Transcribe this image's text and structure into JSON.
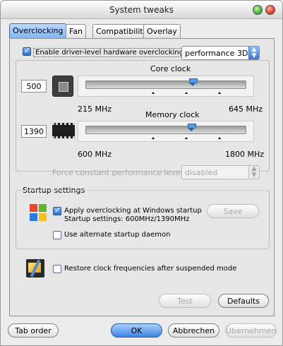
{
  "window": {
    "title": "System tweaks"
  },
  "tabs": [
    {
      "label": "Overclocking",
      "active": true
    },
    {
      "label": "Fan",
      "active": false
    },
    {
      "label": "Compatibility",
      "active": false
    },
    {
      "label": "Overlay",
      "active": false
    }
  ],
  "overclock": {
    "enable_label": "Enable driver-level hardware overclocking",
    "enable_checked": true,
    "mode_value": "performance 3D"
  },
  "core_clock": {
    "title": "Core clock",
    "value": "500",
    "min_label": "215 MHz",
    "max_label": "645 MHz",
    "slider_fraction": 0.665
  },
  "memory_clock": {
    "title": "Memory clock",
    "value": "1390",
    "min_label": "600 MHz",
    "max_label": "1800 MHz",
    "slider_fraction": 0.658
  },
  "force_level": {
    "label": "Force constant performance level",
    "value": "disabled"
  },
  "startup": {
    "title": "Startup settings",
    "apply_label": "Apply overclocking at Windows startup",
    "apply_checked": true,
    "settings_text": "Startup settings: 600MHz/1390MHz",
    "save_label": "Save",
    "daemon_label": "Use alternate startup daemon",
    "daemon_checked": false
  },
  "restore": {
    "label": "Restore clock frequencies after suspended mode",
    "checked": false
  },
  "buttons": {
    "test": "Test",
    "defaults": "Defaults",
    "tab_order": "Tab order",
    "ok": "OK",
    "cancel": "Abbrechen",
    "apply": "Übernehmen"
  },
  "icons": {
    "gpu_chip": "gpu-chip-icon",
    "memory_chip": "memory-chip-icon",
    "windows_startup": "windows-startup-icon",
    "suspend": "suspend-icon"
  }
}
